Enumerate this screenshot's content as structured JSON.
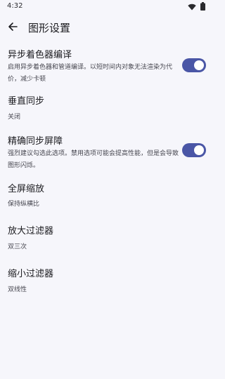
{
  "status_bar": {
    "time": "4:32",
    "icons": [
      "wifi-icon",
      "battery-icon"
    ]
  },
  "app_bar": {
    "back_icon": "arrow-back-icon",
    "title": "图形设置"
  },
  "colors": {
    "background": "#f6f6fb",
    "toggle_track": "#4a56a6",
    "toggle_thumb": "#ffffff"
  },
  "settings": [
    {
      "title": "异步着色器编译",
      "summary": "启用异步着色器和管道编译。以短时间内对象无法渲染为代价，减少卡顿",
      "toggle_on": true
    },
    {
      "title": "垂直同步",
      "summary": "关闭"
    },
    {
      "title": "精确同步屏障",
      "summary": "强烈建议勾选此选项。禁用选项可能会提高性能，但是会导致图形闪烁。",
      "toggle_on": true
    },
    {
      "title": "全屏缩放",
      "summary": "保持纵横比"
    },
    {
      "title": "放大过滤器",
      "summary": "双三次"
    },
    {
      "title": "缩小过滤器",
      "summary": "双线性"
    }
  ]
}
